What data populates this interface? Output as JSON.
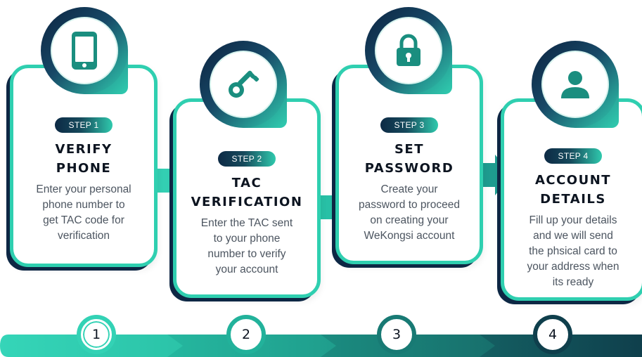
{
  "colors": {
    "accent": "#2fcfb0",
    "dark": "#0d2744",
    "text": "#4c5560",
    "title": "#0c1420"
  },
  "steps": [
    {
      "badge": "STEP 1",
      "title_line1": "VERIFY",
      "title_line2": "PHONE",
      "desc_lines": [
        "Enter your personal",
        "phone number to",
        "get TAC code for",
        "verification"
      ],
      "icon": "phone-icon"
    },
    {
      "badge": "STEP 2",
      "title_line1": "TAC",
      "title_line2": "VERIFICATION",
      "desc_lines": [
        "Enter the TAC sent",
        "to your phone",
        "number to verify",
        "your account"
      ],
      "icon": "key-icon"
    },
    {
      "badge": "STEP 3",
      "title_line1": "SET",
      "title_line2": "PASSWORD",
      "desc_lines": [
        "Create your",
        "password to proceed",
        "on creating your",
        "WeKongsi account"
      ],
      "icon": "lock-icon"
    },
    {
      "badge": "STEP 4",
      "title_line1": "ACCOUNT",
      "title_line2": "DETAILS",
      "desc_lines": [
        "Fill up your details",
        "and we will send",
        "the phsical card to",
        "your address when",
        "its ready"
      ],
      "icon": "user-icon"
    }
  ],
  "timeline": {
    "numbers": [
      "1",
      "2",
      "3",
      "4"
    ]
  }
}
